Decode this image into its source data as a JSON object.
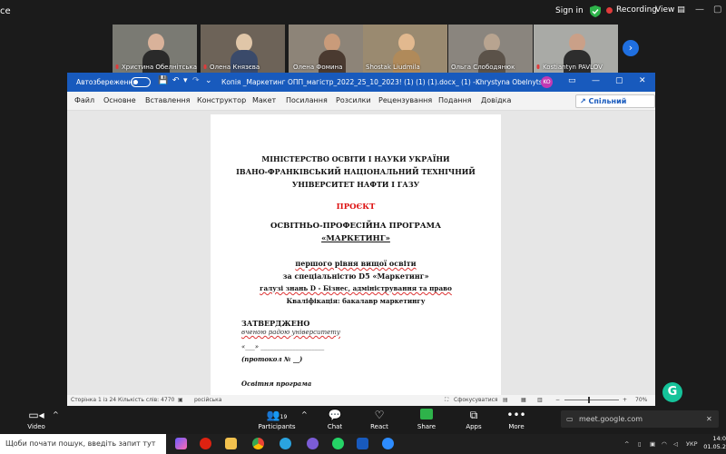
{
  "zoom": {
    "app_fragment": "ce",
    "sign_in": "Sign in",
    "recording": "Recording",
    "view": "View",
    "participants": [
      {
        "name": "Христина Обелнітська"
      },
      {
        "name": "Олена Князєва"
      },
      {
        "name": "Олена Фомина"
      },
      {
        "name": "Shostak Liudmila"
      },
      {
        "name": "Ольга Слободянюк"
      },
      {
        "name": "Kostiantyn PAVLOV"
      }
    ],
    "toolbar": {
      "video": "Video",
      "participants": "Participants",
      "participants_count": "19",
      "chat": "Chat",
      "react": "React",
      "share": "Share",
      "apps": "Apps",
      "more": "More"
    },
    "meet_url": "meet.google.com"
  },
  "word": {
    "autosave": "Автозбереження",
    "doc_title": "Копія _Маркетинг ОПП_магістр_2022_25_10_2023! (1) (1) (1).docx_ (1)  -...",
    "user_name": "Khrystyna Obelnytska",
    "user_initials": "KO",
    "menu": [
      "Файл",
      "Основне",
      "Вставлення",
      "Конструктор",
      "Макет",
      "Посилання",
      "Розсилки",
      "Рецензування",
      "Подання",
      "Довідка"
    ],
    "share_label": "Спільний доступ",
    "status": {
      "page": "Сторінка 1 із 24",
      "words": "Кількість слів: 4770",
      "lang": "російська",
      "focus": "Сфокусуватися",
      "zoom": "70%"
    }
  },
  "document": {
    "header_1": "МІНІСТЕРСТВО ОСВІТИ І НАУКИ УКРАЇНИ",
    "header_2": "ІВАНО-ФРАНКІВСЬКИЙ НАЦІОНАЛЬНИЙ ТЕХНІЧНИЙ",
    "header_3": "УНІВЕРСИТЕТ НАФТИ І ГАЗУ",
    "project": "ПРОЄКТ",
    "program_title": "ОСВІТНЬО-ПРОФЕСІЙНА ПРОГРАМА",
    "program_name": "«МАРКЕТИНГ»",
    "level": "першого рівня вищої освіти",
    "specialty": "за спеціальністю D5 «Маркетинг»",
    "field": "галузі знань D - Бізнес, адміністрування та право",
    "qualification": "Кваліфікація: бакалавр маркетингу",
    "approved": "ЗАТВЕРДЖЕНО",
    "approved_by": "вченою радою університету",
    "date_line": "«___» ____________________",
    "protocol": "(протокол № __)",
    "footer_cut": "Освітня програма"
  },
  "taskbar": {
    "search_placeholder": "Щоби почати пошук, введіть запит тут",
    "lang": "УКР",
    "time": "14:0",
    "date": "01.05.2"
  }
}
